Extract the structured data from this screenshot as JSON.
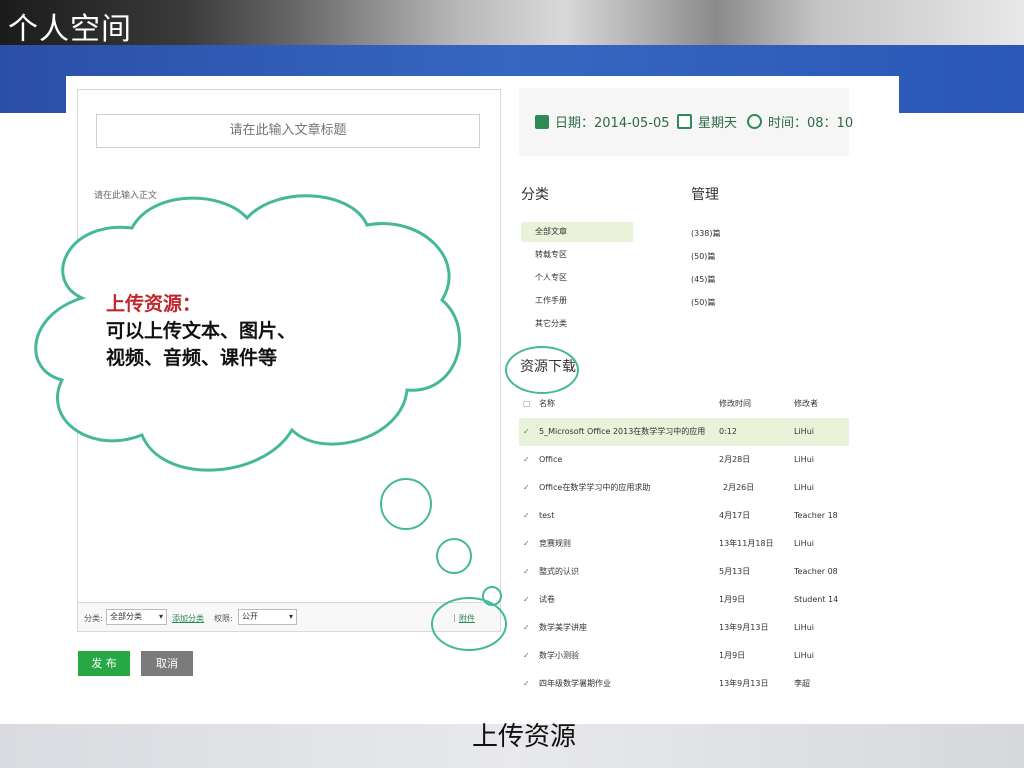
{
  "slide": {
    "title": "个人空间",
    "caption": "上传资源"
  },
  "colors": {
    "accent_blue": "#2f5fb5",
    "green_button": "#27a845",
    "gray_button": "#7b7b7b",
    "bubble_stroke": "#45b89a",
    "highlight_row": "#eaf3d9",
    "callout_title": "#c0272d"
  },
  "editor": {
    "title_placeholder": "请在此输入文章标题",
    "body_placeholder": "请在此输入正文",
    "bottom_bar": {
      "category_label": "分类:",
      "category_value": "全部分类",
      "add_category_link": "添加分类",
      "permission_label": "权限:",
      "permission_value": "公开",
      "attachment_label": "附件"
    },
    "publish_label": "发 布",
    "cancel_label": "取消"
  },
  "datebar": {
    "date_text": "日期：2014-05-05",
    "weekday_text": "星期天",
    "time_text": "时间：08：10",
    "calendar_icon": "calendar-icon",
    "weekday_icon": "day-calendar-icon",
    "alarm_icon": "alarm-clock-icon"
  },
  "categories": {
    "heading": "分类",
    "manage_heading": "管理",
    "items": [
      {
        "label": "全部文章",
        "count": "(338)篇"
      },
      {
        "label": "转载专区",
        "count": "(50)篇"
      },
      {
        "label": "个人专区",
        "count": "(45)篇"
      },
      {
        "label": "工作手册",
        "count": "(50)篇"
      },
      {
        "label": "其它分类",
        "count": ""
      }
    ]
  },
  "resources": {
    "heading": "资源下载",
    "columns": {
      "name": "名称",
      "modified": "修改时间",
      "editor": "修改者"
    },
    "rows": [
      {
        "name": "5_Microsoft Office 2013在数学学习中的应用",
        "time": "0:12",
        "user": "LiHui"
      },
      {
        "name": "Office",
        "time": "2月28日",
        "user": "LiHui"
      },
      {
        "name": "Office在数学学习中的应用求助",
        "time": "2月26日",
        "user": "LiHui"
      },
      {
        "name": "test",
        "time": "4月17日",
        "user": "Teacher 18"
      },
      {
        "name": "竞赛规则",
        "time": "13年11月18日",
        "user": "LiHui"
      },
      {
        "name": "整式的认识",
        "time": "5月13日",
        "user": "Teacher 08"
      },
      {
        "name": "试卷",
        "time": "1月9日",
        "user": "Student 14"
      },
      {
        "name": "数学美学讲座",
        "time": "13年9月13日",
        "user": "LiHui"
      },
      {
        "name": "数学小测验",
        "time": "1月9日",
        "user": "LiHui"
      },
      {
        "name": "四年级数学暑期作业",
        "time": "13年9月13日",
        "user": "李超"
      }
    ]
  },
  "callout": {
    "title": "上传资源：",
    "line1": "可以上传文本、图片、",
    "line2": "视频、音频、课件等"
  }
}
